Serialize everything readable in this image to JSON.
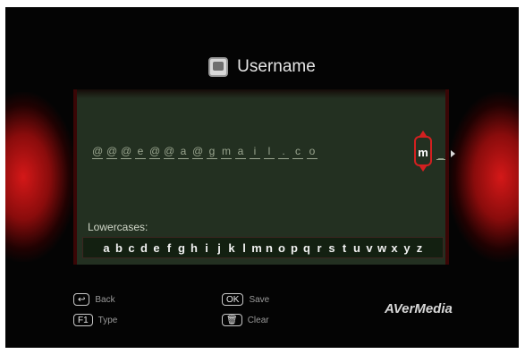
{
  "dialog": {
    "title": "Username",
    "title_icon": "screen-icon"
  },
  "entry": {
    "chars": [
      "@",
      "@",
      "@",
      "e",
      "@",
      "@",
      "a",
      "@",
      "g",
      "m",
      "a",
      "i",
      "l",
      ".",
      "c",
      "o"
    ],
    "cursor_char": "m",
    "trailing_char": "_"
  },
  "keyboard": {
    "label": "Lowercases:",
    "keys": [
      "a",
      "b",
      "c",
      "d",
      "e",
      "f",
      "g",
      "h",
      "i",
      "j",
      "k",
      "l",
      "m",
      "n",
      "o",
      "p",
      "q",
      "r",
      "s",
      "t",
      "u",
      "v",
      "w",
      "x",
      "y",
      "z"
    ]
  },
  "legend": {
    "back": {
      "key": "↩",
      "label": "Back"
    },
    "type": {
      "key": "F1",
      "label": "Type"
    },
    "save": {
      "key": "OK",
      "label": "Save"
    },
    "clear": {
      "key": "🗑",
      "label": "Clear"
    }
  },
  "brand": "AVerMedia",
  "colors": {
    "panel": "#233021",
    "accent": "#d32020",
    "glow": "#d41818"
  }
}
